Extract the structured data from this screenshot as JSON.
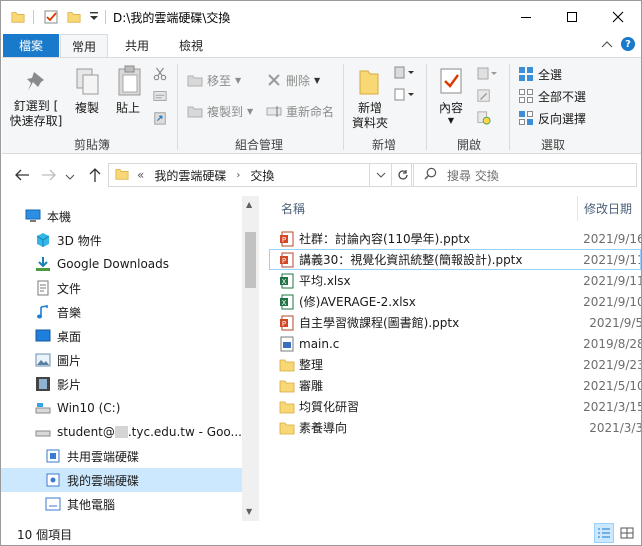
{
  "window": {
    "title": "D:\\我的雲端硬碟\\交換",
    "controls": {
      "minimize": "minimize",
      "maximize": "maximize",
      "close": "close"
    }
  },
  "tabs": {
    "file": "檔案",
    "home": "常用",
    "share": "共用",
    "view": "檢視"
  },
  "ribbon": {
    "pin_quick_access": [
      "釘選到 [",
      "快速存取]"
    ],
    "copy": "複製",
    "paste": "貼上",
    "clipboard_group": "剪貼簿",
    "move_to": "移至",
    "copy_to": "複製到",
    "delete": "刪除",
    "rename": "重新命名",
    "organize_group": "組合管理",
    "new_folder": [
      "新增",
      "資料夾"
    ],
    "new_group": "新增",
    "properties": "內容",
    "open_group": "開啟",
    "select_all": "全選",
    "select_none": "全部不選",
    "invert_selection": "反向選擇",
    "select_group": "選取"
  },
  "address": {
    "chevron": "«",
    "crumbs": [
      "我的雲端硬碟",
      "交換"
    ],
    "search_placeholder": "搜尋 交換"
  },
  "nav": {
    "items": [
      {
        "label": "本機",
        "icon": "computer-icon"
      },
      {
        "label": "3D 物件",
        "icon": "3d-objects-icon"
      },
      {
        "label": "Google Downloads",
        "icon": "download-folder-icon"
      },
      {
        "label": "文件",
        "icon": "documents-icon"
      },
      {
        "label": "音樂",
        "icon": "music-icon"
      },
      {
        "label": "桌面",
        "icon": "desktop-icon"
      },
      {
        "label": "圖片",
        "icon": "pictures-icon"
      },
      {
        "label": "影片",
        "icon": "videos-icon"
      },
      {
        "label": "Win10 (C:)",
        "icon": "drive-c-icon"
      },
      {
        "label_prefix": "student@",
        "label_suffix": ".tyc.edu.tw - Goo...",
        "icon": "network-drive-icon"
      },
      {
        "label": "共用雲端硬碟",
        "icon": "shared-drive-icon"
      },
      {
        "label": "我的雲端硬碟",
        "icon": "my-drive-icon"
      },
      {
        "label": "其他電腦",
        "icon": "other-computers-icon"
      }
    ]
  },
  "filelist": {
    "col_name": "名稱",
    "col_date": "修改日期",
    "rows": [
      {
        "name": "社群：討論內容(110學年).pptx",
        "date": "2021/9/16",
        "icon": "pptx-icon"
      },
      {
        "name": "講義30：視覺化資訊統整(簡報設計).pptx",
        "date": "2021/9/11",
        "icon": "pptx-icon"
      },
      {
        "name": "平均.xlsx",
        "date": "2021/9/11",
        "icon": "xlsx-icon"
      },
      {
        "name": "(修)AVERAGE-2.xlsx",
        "date": "2021/9/10",
        "icon": "xlsx-icon"
      },
      {
        "name": "自主學習微課程(圖書館).pptx",
        "date": "2021/9/5",
        "icon": "pptx-icon"
      },
      {
        "name": "main.c",
        "date": "2019/8/28",
        "icon": "c-file-icon"
      },
      {
        "name": "整理",
        "date": "2021/9/23",
        "icon": "folder-icon"
      },
      {
        "name": "審雕",
        "date": "2021/5/10",
        "icon": "folder-icon"
      },
      {
        "name": "均質化研習",
        "date": "2021/3/15",
        "icon": "folder-icon"
      },
      {
        "name": "素養導向",
        "date": "2021/3/3",
        "icon": "folder-icon"
      }
    ]
  },
  "status": {
    "count": "10 個項目"
  },
  "colors": {
    "file_tab": "#1979ca",
    "selected": "#cce8ff",
    "folder": "#f8d775"
  }
}
